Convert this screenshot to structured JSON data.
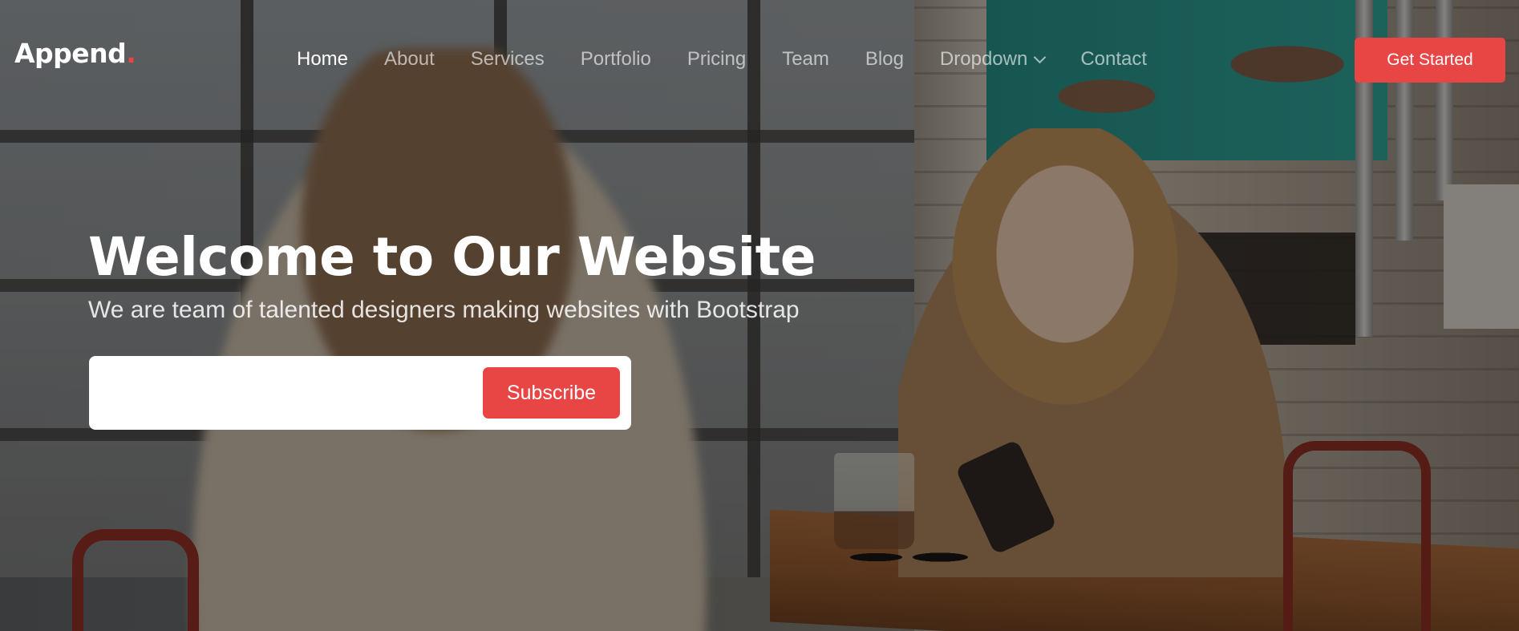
{
  "header": {
    "logo_text": "Append",
    "logo_dot": ".",
    "nav": [
      {
        "label": "Home",
        "active": true
      },
      {
        "label": "About",
        "active": false
      },
      {
        "label": "Services",
        "active": false
      },
      {
        "label": "Portfolio",
        "active": false
      },
      {
        "label": "Pricing",
        "active": false
      },
      {
        "label": "Team",
        "active": false
      },
      {
        "label": "Blog",
        "active": false
      },
      {
        "label": "Dropdown",
        "active": false,
        "icon": "chevron-down-icon"
      },
      {
        "label": "Contact",
        "active": false
      }
    ],
    "cta_label": "Get Started"
  },
  "hero": {
    "title": "Welcome to Our Website",
    "subtitle": "We are team of talented designers making websites with Bootstrap",
    "email_value": "",
    "subscribe_label": "Subscribe"
  },
  "colors": {
    "accent": "#e84545",
    "text_light": "#ffffff",
    "overlay": "#0c0a08"
  }
}
